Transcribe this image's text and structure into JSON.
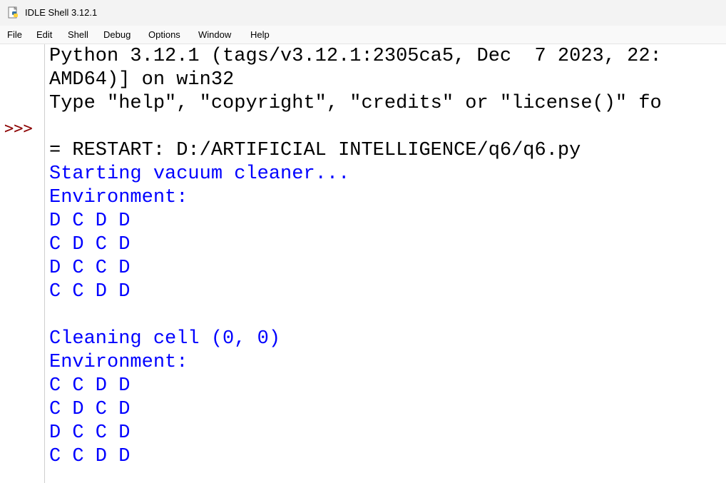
{
  "window": {
    "title": "IDLE Shell 3.12.1",
    "icon": "python-idle-icon"
  },
  "menu": [
    "File",
    "Edit",
    "Shell",
    "Debug",
    "Options",
    "Window",
    "Help"
  ],
  "prompt": ">>>",
  "lines": [
    {
      "text": "Python 3.12.1 (tags/v3.12.1:2305ca5, Dec  7 2023, 22:",
      "color": "black"
    },
    {
      "text": "AMD64)] on win32",
      "color": "black"
    },
    {
      "text": "Type \"help\", \"copyright\", \"credits\" or \"license()\" fo",
      "color": "black"
    },
    {
      "text": "",
      "color": "black"
    },
    {
      "text": "= RESTART: D:/ARTIFICIAL INTELLIGENCE/q6/q6.py",
      "color": "black"
    },
    {
      "text": "Starting vacuum cleaner...",
      "color": "blue"
    },
    {
      "text": "Environment:",
      "color": "blue"
    },
    {
      "text": "D C D D",
      "color": "blue"
    },
    {
      "text": "C D C D",
      "color": "blue"
    },
    {
      "text": "D C C D",
      "color": "blue"
    },
    {
      "text": "C C D D",
      "color": "blue"
    },
    {
      "text": "",
      "color": "blue"
    },
    {
      "text": "Cleaning cell (0, 0)",
      "color": "blue"
    },
    {
      "text": "Environment:",
      "color": "blue"
    },
    {
      "text": "C C D D",
      "color": "blue"
    },
    {
      "text": "C D C D",
      "color": "blue"
    },
    {
      "text": "D C C D",
      "color": "blue"
    },
    {
      "text": "C C D D",
      "color": "blue"
    }
  ],
  "colors": {
    "stdout": "#0000ff",
    "banner": "#000000",
    "prompt": "#8b0000"
  }
}
